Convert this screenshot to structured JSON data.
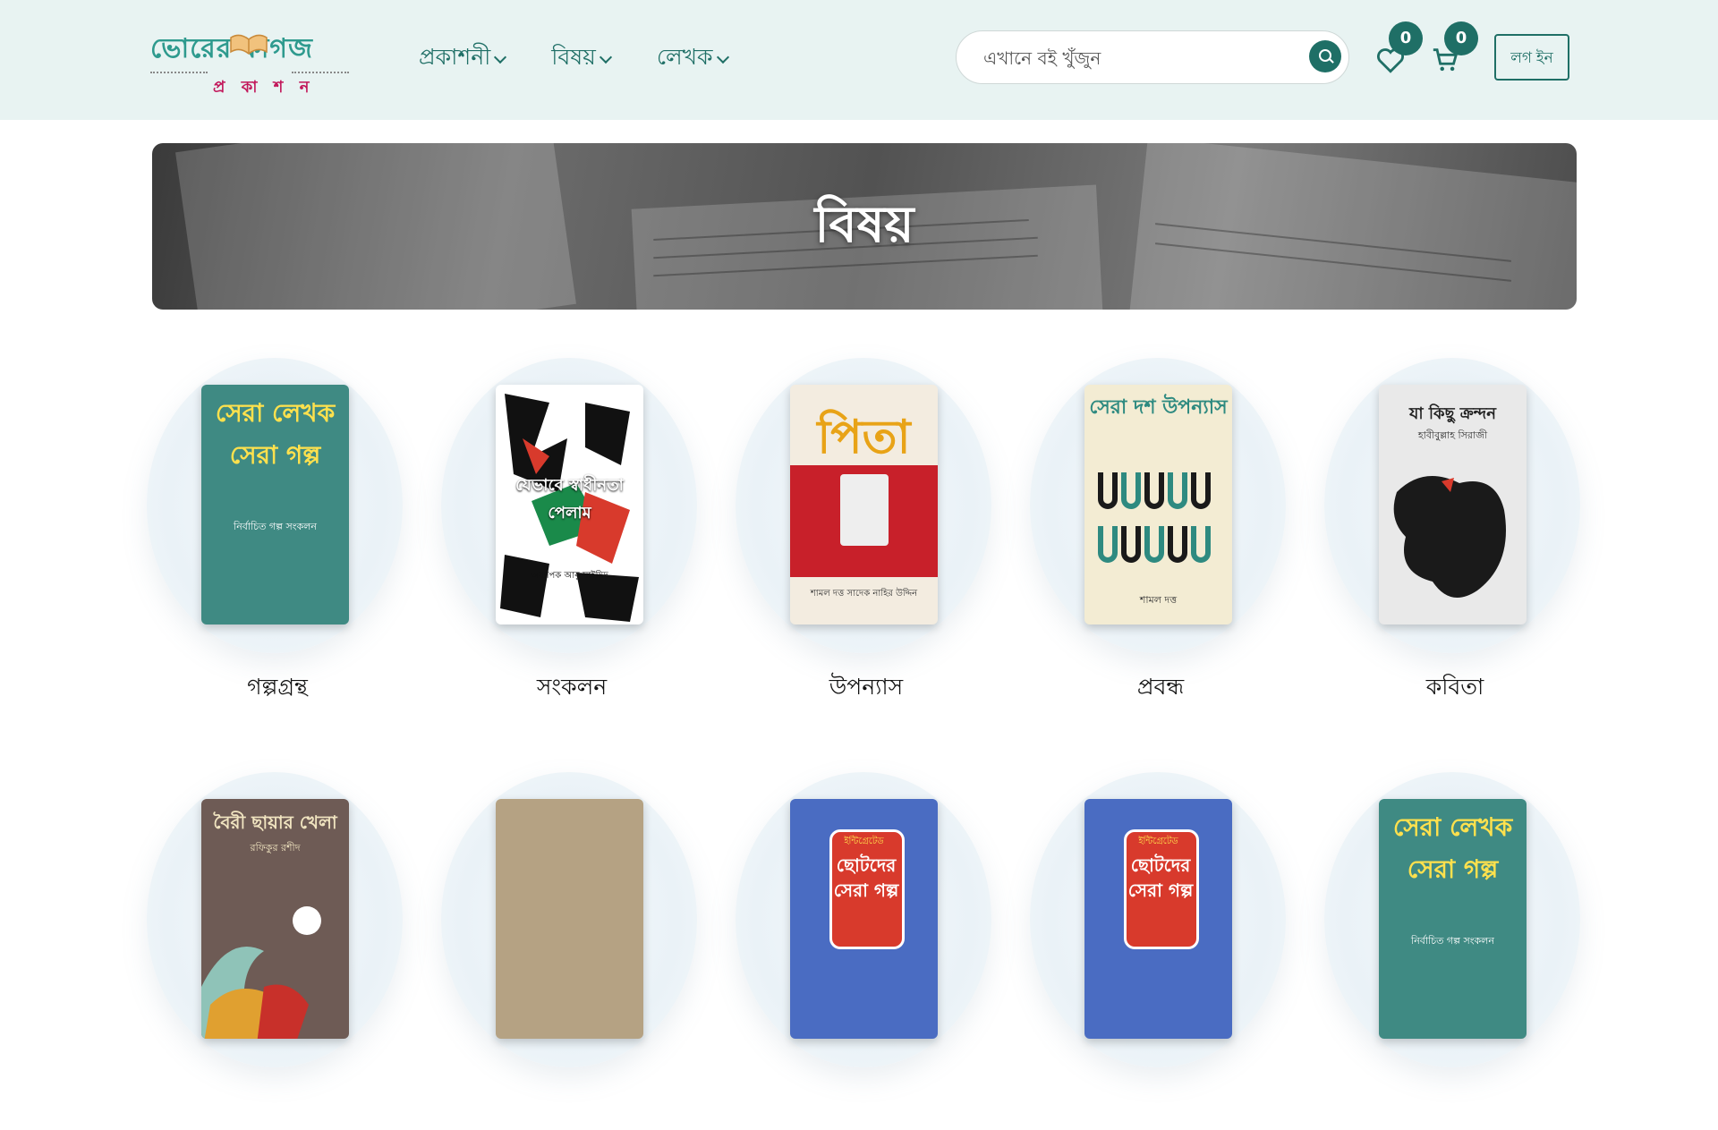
{
  "header": {
    "logo_top": "ভোরের কাগজ",
    "logo_bottom": "প্র কা শ ন",
    "nav": [
      {
        "label": "প্রকাশনী"
      },
      {
        "label": "বিষয়"
      },
      {
        "label": "লেখক"
      }
    ],
    "search_placeholder": "এখানে বই খুঁজুন",
    "wishlist_count": "0",
    "cart_count": "0",
    "login_label": "লগ ইন"
  },
  "banner": {
    "title": "বিষয়"
  },
  "categories": [
    {
      "label": "গল্পগ্রন্থ",
      "cover_title": "সেরা লেখক সেরা গল্প",
      "cover_sub": "নির্বাচিত গল্প সংকলন",
      "cover_bg": "#3f8a83",
      "cover_fg": "#ffe14d"
    },
    {
      "label": "সংকলন",
      "cover_title": "যেভাবে স্বাধীনতা পেলাম",
      "cover_sub": "অধ্যাপক আবু সাইয়িদ",
      "cover_bg": "#ffffff",
      "cover_fg": "#111111"
    },
    {
      "label": "উপন্যাস",
      "cover_title": "পিতা",
      "cover_sub": "শামল দত্ত সাদেক নাহির উদ্দিন",
      "cover_bg": "#f3ece0",
      "cover_fg": "#e8a317"
    },
    {
      "label": "প্রবন্ধ",
      "cover_title": "সেরা দশ উপন্যাস",
      "cover_sub": "শামল দত্ত",
      "cover_bg": "#f3ecd3",
      "cover_fg": "#2e8a80"
    },
    {
      "label": "কবিতা",
      "cover_title": "যা কিছু ক্রন্দন",
      "cover_sub": "হাবীবুল্লাহ সিরাজী",
      "cover_bg": "#e9e9e9",
      "cover_fg": "#222222"
    },
    {
      "label": "",
      "cover_title": "বৈরী ছায়ার খেলা",
      "cover_sub": "রফিকুর রশীদ",
      "cover_bg": "#6e5b55",
      "cover_fg": "#f0e4c0"
    },
    {
      "label": "",
      "cover_title": "",
      "cover_sub": "",
      "cover_bg": "#b5a283",
      "cover_fg": "#000000"
    },
    {
      "label": "",
      "cover_title": "ছোটদের সেরা গল্প",
      "cover_sub": "ইন্টিগ্রেটেড",
      "cover_bg": "#4a6cc2",
      "cover_fg": "#ffffff"
    },
    {
      "label": "",
      "cover_title": "ছোটদের সেরা গল্প",
      "cover_sub": "ইন্টিগ্রেটেড",
      "cover_bg": "#4a6cc2",
      "cover_fg": "#ffffff"
    },
    {
      "label": "",
      "cover_title": "সেরা লেখক সেরা গল্প",
      "cover_sub": "নির্বাচিত গল্প সংকলন",
      "cover_bg": "#3f8a83",
      "cover_fg": "#ffe14d"
    }
  ]
}
